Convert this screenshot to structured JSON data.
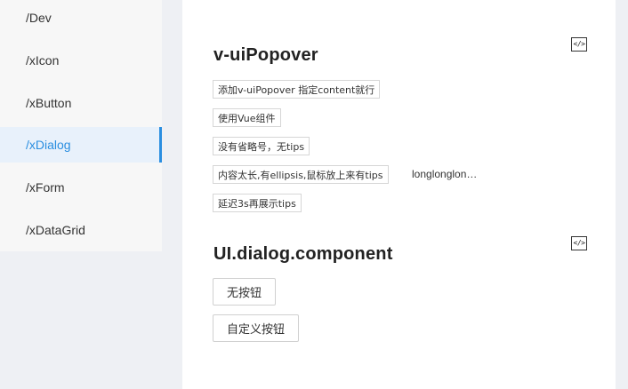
{
  "sidebar": {
    "items": [
      {
        "label": "/Dev",
        "active": false
      },
      {
        "label": "/xIcon",
        "active": false
      },
      {
        "label": "/xButton",
        "active": false
      },
      {
        "label": "/xDialog",
        "active": true
      },
      {
        "label": "/xForm",
        "active": false
      },
      {
        "label": "/xDataGrid",
        "active": false
      }
    ]
  },
  "sections": [
    {
      "title": "v-uiPopover",
      "code_icon": "</>",
      "buttons": [
        "添加v-uiPopover 指定content就行",
        "使用Vue组件",
        "没有省略号，无tips",
        "内容太长,有ellipsis,鼠标放上来有tips",
        "延迟3s再展示tips"
      ],
      "truncated_text": "longlonglongtext"
    },
    {
      "title": "UI.dialog.component",
      "code_icon": "</>",
      "buttons": [
        "无按钮",
        "自定义按钮"
      ]
    }
  ],
  "colors": {
    "accent": "#2a8ee0",
    "page_bg": "#eef0f4",
    "sidebar_bg": "#f7f7f7"
  }
}
